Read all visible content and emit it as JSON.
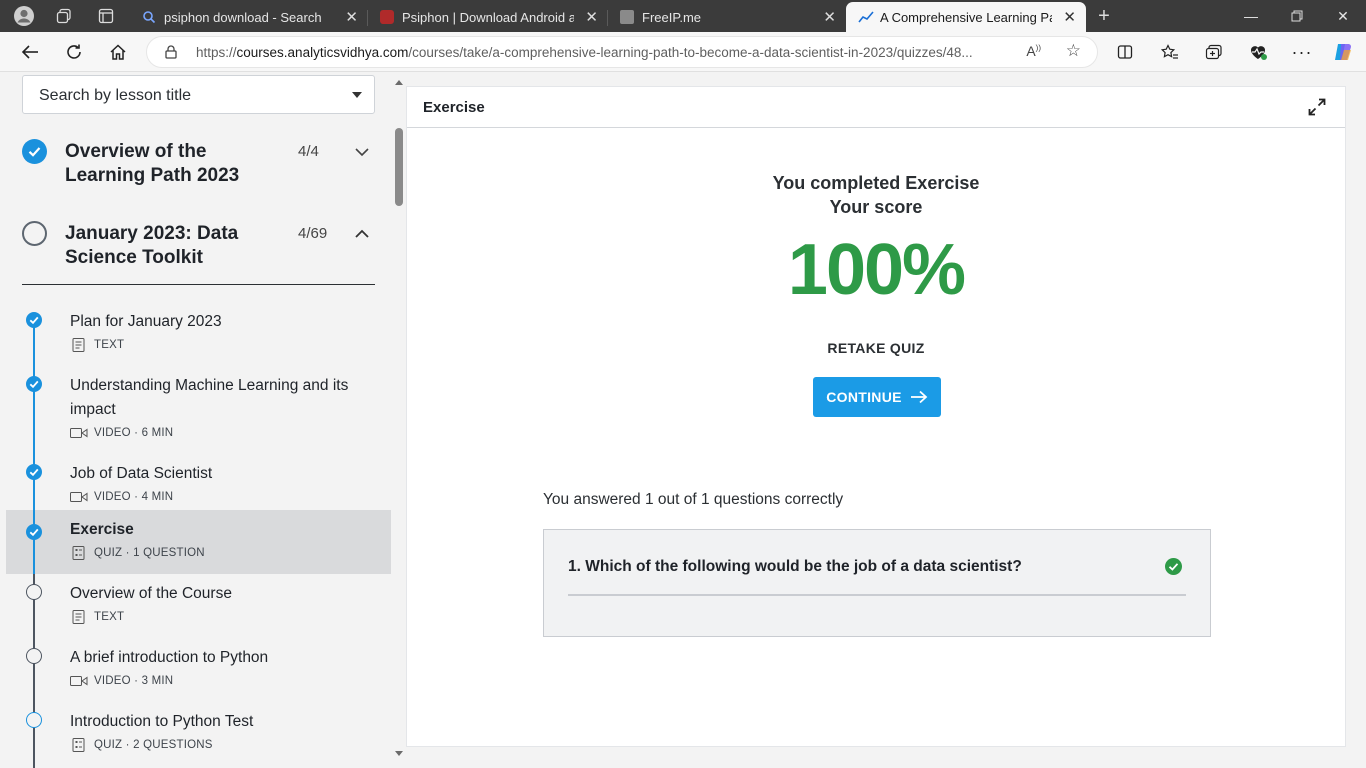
{
  "browser": {
    "tabs": [
      {
        "title": "psiphon download - Search",
        "favicon": "search-icon"
      },
      {
        "title": "Psiphon | Download Android app",
        "favicon": "psiphon-icon"
      },
      {
        "title": "FreeIP.me",
        "favicon": "freeip-icon"
      },
      {
        "title": "A Comprehensive Learning Path t",
        "favicon": "analyticsvidhya-icon"
      }
    ],
    "url": {
      "scheme": "https://",
      "host": "courses.analyticsvidhya.com",
      "path": "/courses/take/a-comprehensive-learning-path-to-become-a-data-scientist-in-2023/quizzes/48..."
    }
  },
  "sidebar": {
    "search_placeholder": "Search by lesson title",
    "sections": [
      {
        "title": "Overview of the Learning Path 2023",
        "count": "4/4",
        "complete": true,
        "expanded": false
      },
      {
        "title": "January 2023: Data Science Toolkit",
        "count": "4/69",
        "complete": false,
        "expanded": true
      }
    ],
    "lessons": [
      {
        "title": "Plan for January 2023",
        "meta": "TEXT",
        "type": "text",
        "status": "done"
      },
      {
        "title": "Understanding Machine Learning and its impact",
        "meta": "VIDEO · 6 MIN",
        "type": "video",
        "status": "done"
      },
      {
        "title": "Job of Data Scientist",
        "meta": "VIDEO · 4 MIN",
        "type": "video",
        "status": "done"
      },
      {
        "title": "Exercise",
        "meta": "QUIZ · 1 QUESTION",
        "type": "quiz",
        "status": "done",
        "active": true
      },
      {
        "title": "Overview of the Course",
        "meta": "TEXT",
        "type": "text",
        "status": "todo"
      },
      {
        "title": "A brief introduction to Python",
        "meta": "VIDEO · 3 MIN",
        "type": "video",
        "status": "todo"
      },
      {
        "title": "Introduction to Python Test",
        "meta": "QUIZ · 2 QUESTIONS",
        "type": "quiz",
        "status": "todo"
      }
    ]
  },
  "main": {
    "header": "Exercise",
    "completed_line1": "You completed Exercise",
    "completed_line2": "Your score",
    "score": "100%",
    "retake_label": "RETAKE QUIZ",
    "continue_label": "CONTINUE",
    "answered_text": "You answered 1 out of 1 questions correctly",
    "question": "1. Which of the following would be the job of a data scientist?"
  },
  "colors": {
    "accent": "#1b9be6",
    "score_green": "#2e9a47",
    "done_blue": "#1a91dd"
  }
}
